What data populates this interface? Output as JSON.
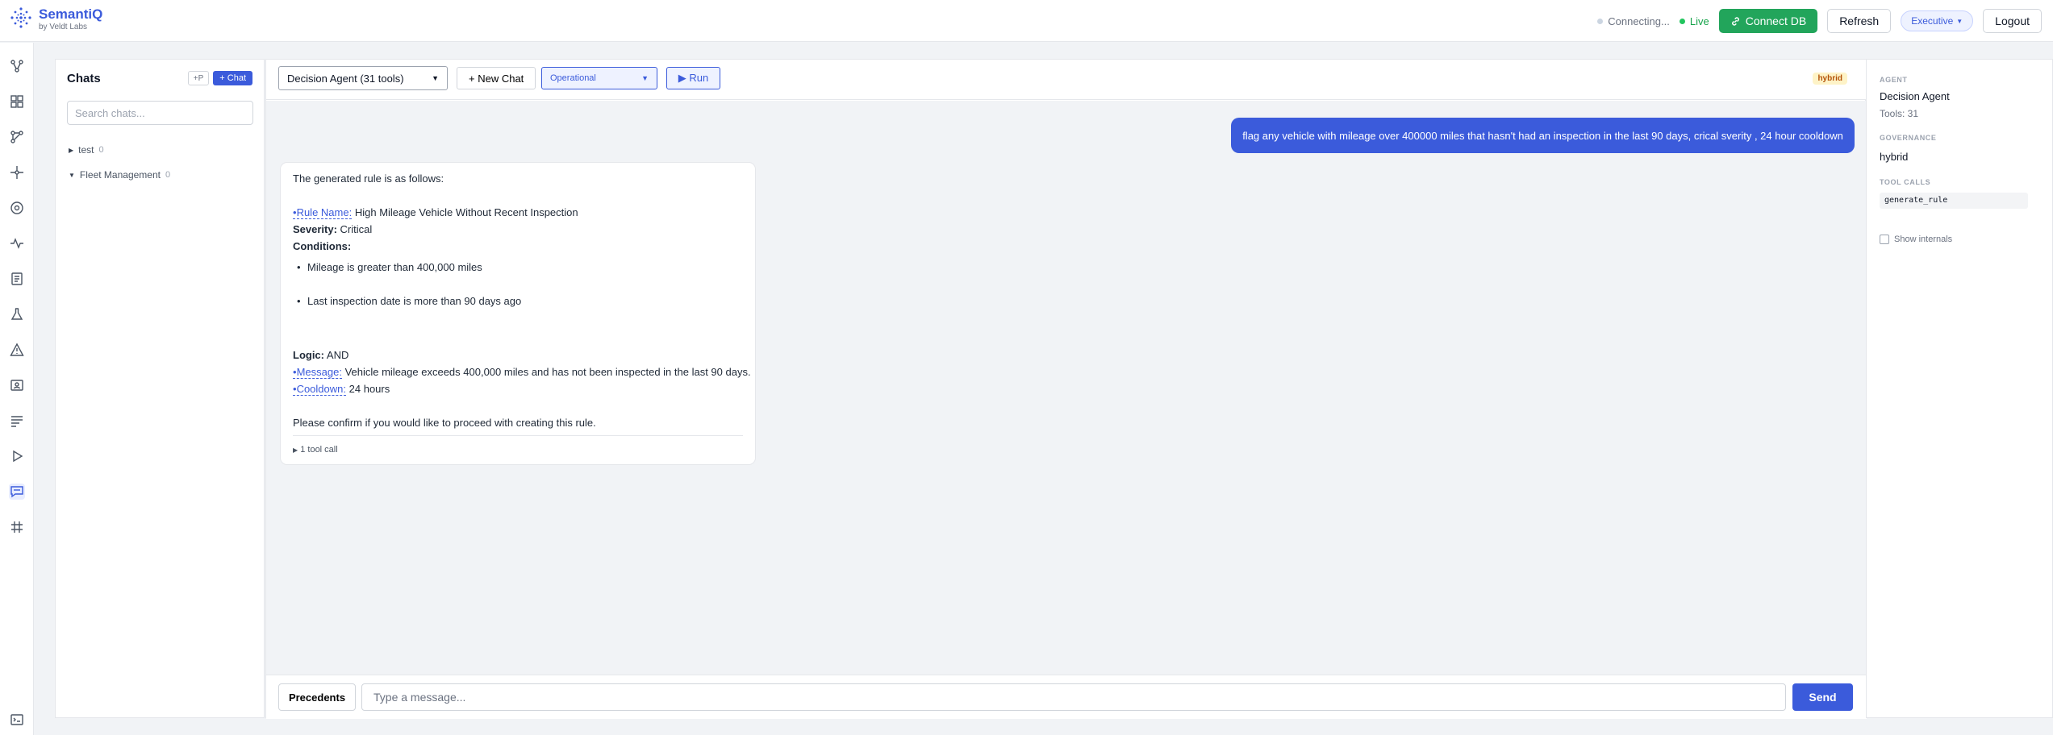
{
  "app": {
    "name": "SemantiQ",
    "subtitle": "by Veldt Labs"
  },
  "topbar": {
    "status_connecting": "Connecting...",
    "status_live": "Live",
    "connect_label": "Connect DB",
    "refresh_label": "Refresh",
    "role_label": "Executive",
    "logout_label": "Logout"
  },
  "sidebar": {
    "title": "Chats",
    "xp_label": "+P",
    "new_chat_label": "+ Chat",
    "search_placeholder": "Search chats...",
    "folders": [
      {
        "name": "test",
        "count": "0",
        "expanded": false
      },
      {
        "name": "Fleet Management",
        "count": "0",
        "expanded": true
      }
    ]
  },
  "toolbar": {
    "agent_select": "Decision Agent (31 tools)",
    "new_chat_label": "+ New Chat",
    "mode_select": "Operational",
    "run_label": "▶ Run",
    "governance_badge": "hybrid"
  },
  "conversation": {
    "user_message": "flag any vehicle with mileage over 400000 miles that hasn't had an inspection in the last 90 days, crical sverity , 24 hour cooldown",
    "assistant": {
      "intro": "The generated rule is as follows:",
      "rule_name_label": "Rule Name",
      "rule_name_value": "High Mileage Vehicle Without Recent Inspection",
      "severity_label": "Severity:",
      "severity_value": "Critical",
      "conditions_label": "Conditions:",
      "conditions": [
        "Mileage is greater than 400,000 miles",
        "Last inspection date is more than 90 days ago"
      ],
      "logic_label": "Logic:",
      "logic_value": "AND",
      "message_label": "Message",
      "message_value": "Vehicle mileage exceeds 400,000 miles and has not been inspected in the last 90 days.",
      "cooldown_label": "Cooldown",
      "cooldown_value": "24 hours",
      "closing": "Please confirm if you would like to proceed with creating this rule.",
      "tool_call_toggle": "1 tool call"
    }
  },
  "input": {
    "precedents_label": "Precedents",
    "placeholder": "Type a message...",
    "send_label": "Send"
  },
  "right_panel": {
    "agent_label": "AGENT",
    "agent_name": "Decision Agent",
    "tools_count": "Tools: 31",
    "governance_label": "GOVERNANCE",
    "governance_value": "hybrid",
    "tool_calls_label": "TOOL CALLS",
    "tool_call": "generate_rule",
    "show_internals_label": "Show internals"
  },
  "colors": {
    "accent": "#3b5bdb",
    "connect": "#22a55b",
    "live": "#16a34a",
    "badge_bg": "#fef3c7",
    "badge_fg": "#b45309"
  },
  "icons": [
    "logo-icon",
    "graph-icon",
    "grid-icon",
    "network-icon",
    "flow-icon",
    "target-icon",
    "pulse-icon",
    "document-icon",
    "flask-icon",
    "warning-icon",
    "contact-icon",
    "list-icon",
    "play-icon",
    "chat-icon",
    "hash-icon",
    "terminal-icon"
  ]
}
